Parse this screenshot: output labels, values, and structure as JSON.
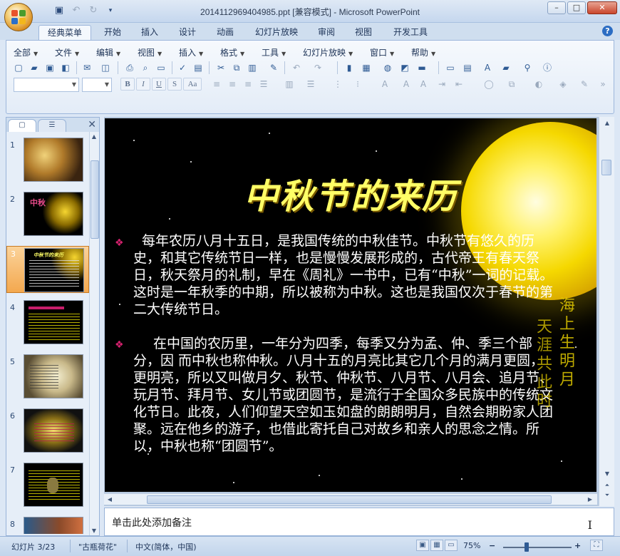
{
  "window": {
    "title": "2014112969404985.ppt [兼容模式] - Microsoft PowerPoint",
    "controls": [
      "–",
      "□",
      "✕"
    ]
  },
  "ribbon_tabs": [
    "经典菜单",
    "开始",
    "插入",
    "设计",
    "动画",
    "幻灯片放映",
    "审阅",
    "视图",
    "开发工具"
  ],
  "active_tab": "经典菜单",
  "menus": [
    "全部",
    "文件",
    "编辑",
    "视图",
    "插入",
    "格式",
    "工具",
    "幻灯片放映",
    "窗口",
    "帮助"
  ],
  "format_buttons": [
    "B",
    "I",
    "U",
    "S",
    "Aa"
  ],
  "slide_panel": {
    "thumbnails": [
      {
        "num": "1",
        "text": ""
      },
      {
        "num": "2",
        "text": "中秋"
      },
      {
        "num": "3",
        "text": "中秋节的来历"
      },
      {
        "num": "4",
        "text": ""
      },
      {
        "num": "5",
        "text": ""
      },
      {
        "num": "6",
        "text": ""
      },
      {
        "num": "7",
        "text": ""
      },
      {
        "num": "8",
        "text": ""
      }
    ],
    "selected": "3"
  },
  "slide": {
    "title": "中秋节的来历",
    "para1": "每年农历八月十五日，是我国传统的中秋佳节。中秋节有悠久的历史，和其它传统节日一样，也是慢慢发展形成的，古代帝王有春天祭日，秋天祭月的礼制，早在《周礼》一书中，已有“中秋”一词的记载。这时是一年秋季的中期，所以被称为中秋。这也是我国仅次于春节的第二大传统节日。",
    "para2": "在中国的农历里，一年分为四季，每季又分为孟、仲、季三个部分，因 而中秋也称仲秋。八月十五的月亮比其它几个月的满月更圆，更明亮，所以又叫做月夕、秋节、仲秋节、八月节、八月会、追月节、玩月节、拜月节、女儿节或团圆节，是流行于全国众多民族中的传统文化节日。此夜，人们仰望天空如玉如盘的朗朗明月，自然会期盼家人团聚。远在他乡的游子，也借此寄托自己对故乡和亲人的思念之情。所以，中秋也称“团圆节”。",
    "poem_col1": "海上生明月",
    "poem_col2": "天涯共此时",
    "colors": {
      "background": "#000000",
      "title": "#ffff66",
      "text": "#ffffff",
      "bullet": "#d6216e",
      "moon": "#f5d800"
    }
  },
  "notes": {
    "placeholder": "单击此处添加备注"
  },
  "status": {
    "slide_counter": "幻灯片 3/23",
    "theme": "\"古瓶荷花\"",
    "language": "中文(简体，中国)",
    "zoom": "75%",
    "zoom_value": 0.75
  },
  "icons": [
    "office-button-icon",
    "save-icon",
    "undo-icon",
    "redo-icon",
    "help-icon",
    "close-icon"
  ]
}
